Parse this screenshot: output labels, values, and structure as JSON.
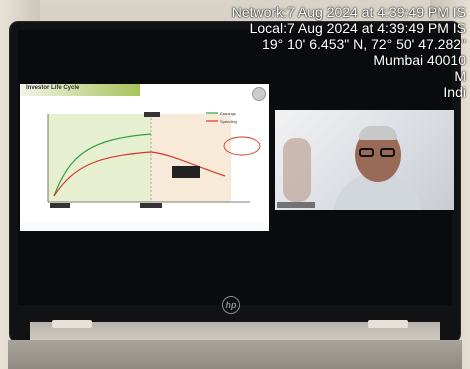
{
  "overlay": {
    "network": "Network:7 Aug 2024 at 4:39:49 PM IS",
    "local": "Local:7 Aug 2024 at 4:39:49 PM IS",
    "coords": "19° 10' 6.453\" N, 72° 50' 47.282\"",
    "city": "Mumbai 40010",
    "line5": "M",
    "line6": "Indi"
  },
  "slide": {
    "title": "Investor Life Cycle",
    "legend": [
      "Earnings",
      "Spending"
    ],
    "chart_data": {
      "type": "line",
      "title": "Investor Life Cycle",
      "xlabel": "Age / Time Line",
      "series": [
        {
          "name": "Earnings",
          "color": "#2ea043"
        },
        {
          "name": "Spending",
          "color": "#d33a2c"
        }
      ]
    },
    "colors": {
      "earnings": "#2ea043",
      "spending": "#d33a2c",
      "band": "#a8c35a"
    }
  }
}
